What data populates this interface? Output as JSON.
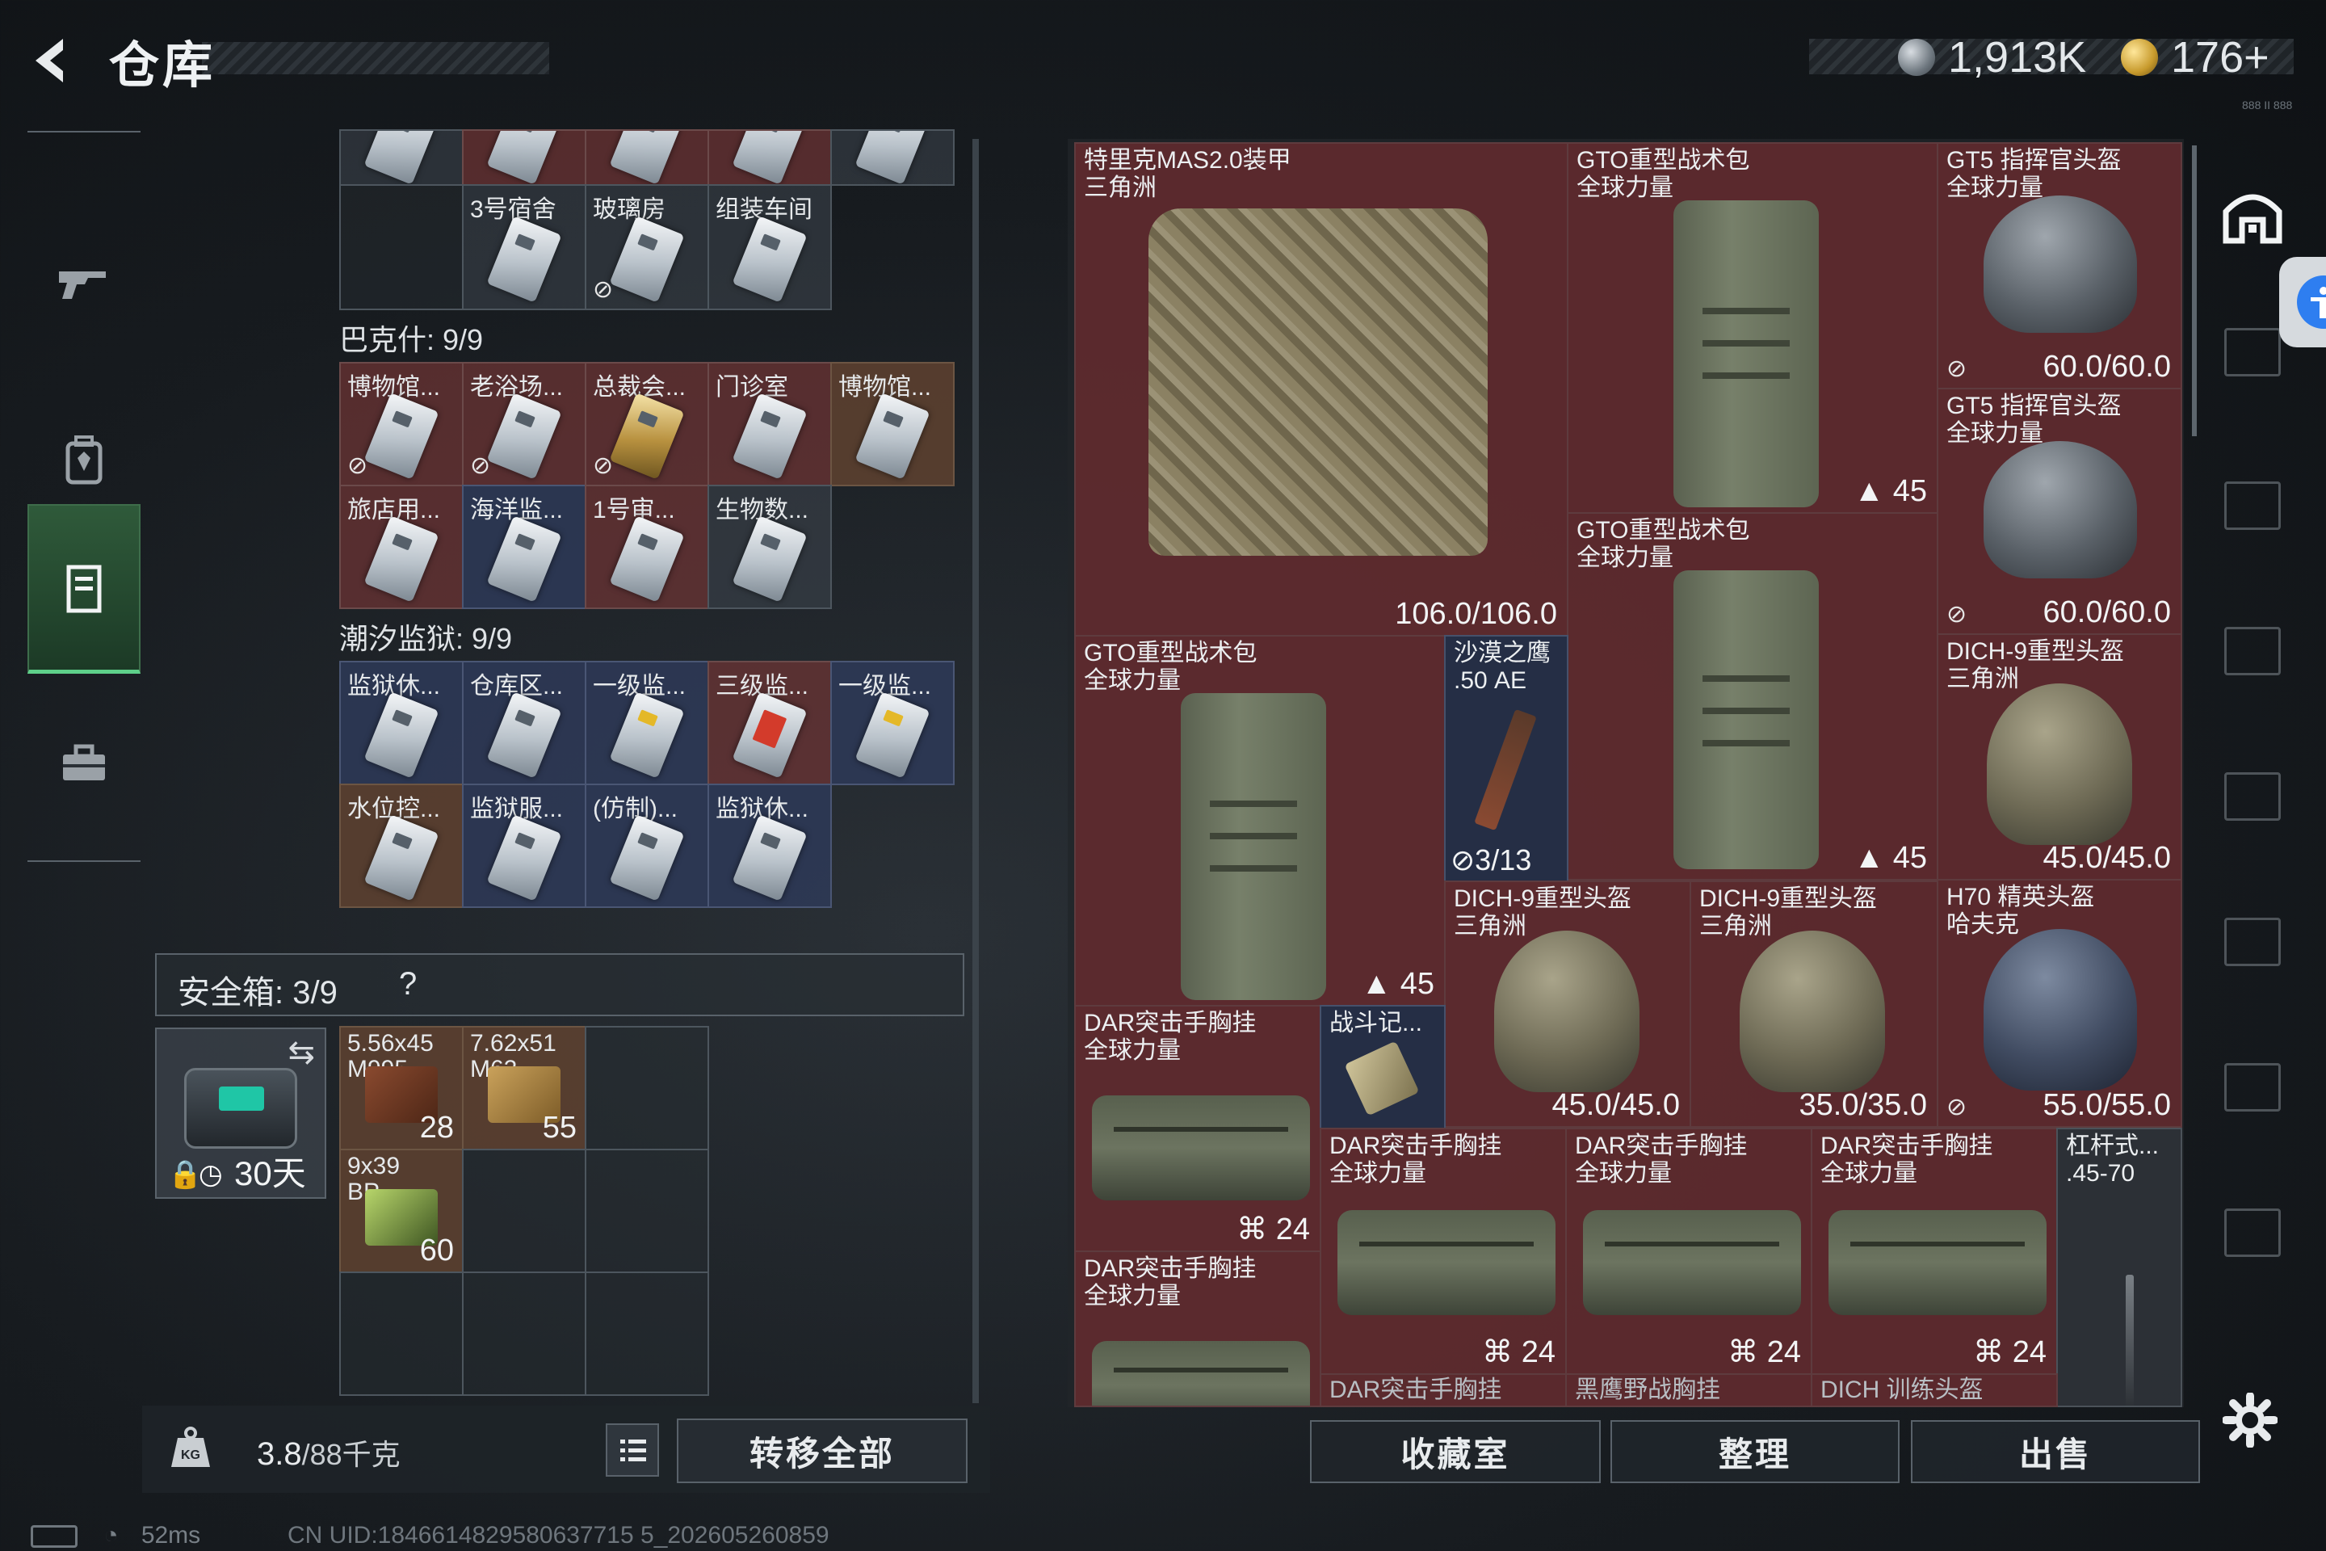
{
  "header": {
    "title": "仓库",
    "coins": "1,913K",
    "gold": "176+",
    "small_text": "888 II 888"
  },
  "left_nav": {
    "items": [
      {
        "name": "weapons",
        "icon": "gun-icon"
      },
      {
        "name": "backpack",
        "icon": "backpack-icon"
      },
      {
        "name": "warehouse",
        "icon": "locker-icon",
        "active": true
      },
      {
        "name": "toolbox",
        "icon": "toolbox-icon"
      }
    ]
  },
  "keycards": {
    "top_row_labels": [
      "3号宿舍",
      "玻璃房",
      "组装车间"
    ],
    "bakshi": {
      "title": "巴克什: 9/9",
      "items": [
        "博物馆...",
        "老浴场...",
        "总裁会...",
        "门诊室",
        "博物馆...",
        "旅店用...",
        "海洋监...",
        "1号审...",
        "生物数..."
      ]
    },
    "prison": {
      "title": "潮汐监狱: 9/9",
      "items": [
        "监狱休...",
        "仓库区...",
        "一级监...",
        "三级监...",
        "一级监...",
        "水位控...",
        "监狱服...",
        "(仿制)...",
        "监狱休..."
      ]
    }
  },
  "safe_box": {
    "label": "安全箱: 3/9",
    "help": "?",
    "duration": "30天",
    "ammo": [
      {
        "name": "5.56x45\nM995",
        "count": "28"
      },
      {
        "name": "7.62x51\nM62",
        "count": "55"
      },
      {
        "name": "9x39\nBP",
        "count": "60"
      }
    ]
  },
  "bottom_left": {
    "weight": "3.8",
    "weight_max": "/88千克",
    "transfer_all": "转移全部"
  },
  "status": {
    "ping": "52ms",
    "uid": "CN UID:1846614829580637715 5_202605260859"
  },
  "inventory": {
    "armor": {
      "name": "特里克MAS2.0装甲\n三角洲",
      "durability": "106.0/106.0"
    },
    "pack1": {
      "name": "GTO重型战术包\n全球力量",
      "slots": "45"
    },
    "helmet1": {
      "name": "GT5 指挥官头盔\n全球力量",
      "durability": "60.0/60.0"
    },
    "helmet2": {
      "name": "GT5 指挥官头盔\n全球力量",
      "durability": "60.0/60.0"
    },
    "pack2": {
      "name": "GTO重型战术包\n全球力量",
      "slots": "45"
    },
    "pack3": {
      "name": "GTO重型战术包\n全球力量",
      "slots": "45"
    },
    "deagle": {
      "name": "沙漠之鹰\n.50 AE",
      "count": "3/13"
    },
    "dich1": {
      "name": "DICH-9重型头盔\n三角洲",
      "durability": "45.0/45.0"
    },
    "dich2": {
      "name": "DICH-9重型头盔\n三角洲",
      "durability": "45.0/45.0"
    },
    "dich3": {
      "name": "DICH-9重型头盔\n三角洲",
      "durability": "35.0/35.0"
    },
    "h70": {
      "name": "H70 精英头盔\n哈夫克",
      "durability": "55.0/55.0"
    },
    "dar1": {
      "name": "DAR突击手胸挂\n全球力量",
      "slots": "24"
    },
    "battlelog": {
      "name": "战斗记..."
    },
    "dar2": {
      "name": "DAR突击手胸挂\n全球力量",
      "slots": "24"
    },
    "dar3": {
      "name": "DAR突击手胸挂\n全球力量",
      "slots": "24"
    },
    "dar4": {
      "name": "DAR突击手胸挂\n全球力量",
      "slots": "24"
    },
    "dar5": {
      "name": "DAR突击手胸挂\n全球力量"
    },
    "lever": {
      "name": "杠杆式...\n.45-70"
    },
    "bottom_partial": [
      "DAR突击手胸挂",
      "黑鹰野战胸挂",
      "DICH 训练头盔"
    ]
  },
  "bottom_right": {
    "collection": "收藏室",
    "organize": "整理",
    "sell": "出售"
  }
}
